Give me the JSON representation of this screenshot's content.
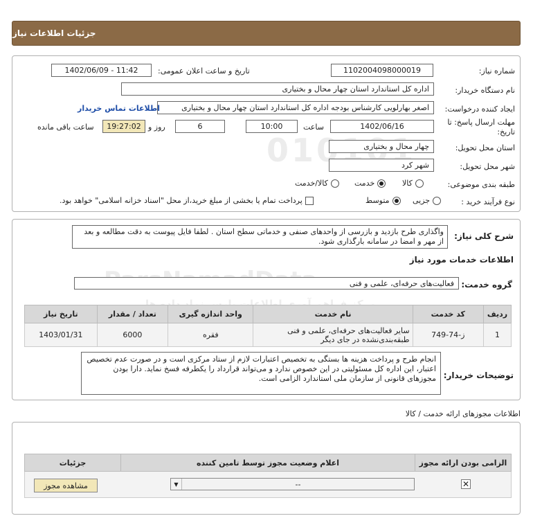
{
  "header": {
    "title": "جزئیات اطلاعات نیاز"
  },
  "form": {
    "need_number_label": "شماره نیاز:",
    "need_number": "1102004098000019",
    "announce_label": "تاریخ و ساعت اعلان عمومی:",
    "announce_value": "1402/06/09 - 11:42",
    "buyer_org_label": "نام دستگاه خریدار:",
    "buyer_org": "اداره کل استاندارد استان چهار محال و بختیاری",
    "creator_label": "ایجاد کننده درخواست:",
    "creator": "اصغر بهارلویی  کارشناس بودجه اداره کل استاندارد استان چهار محال و بختیاری",
    "contact_link": "اطلاعات تماس خریدار",
    "deadline_label_1": "مهلت ارسال پاسخ: تا",
    "deadline_label_2": "تاریخ:",
    "deadline_date": "1402/06/16",
    "time_label": "ساعت",
    "deadline_time": "10:00",
    "days_value": "6",
    "days_label": "روز و",
    "remaining_time": "19:27:02",
    "remaining_label": "ساعت باقی مانده",
    "province_label": "استان محل تحویل:",
    "province": "چهار محال و بختیاری",
    "city_label": "شهر محل تحویل:",
    "city": "شهر کرد",
    "category_label": "طبقه بندی موضوعی:",
    "category_options": [
      "کالا",
      "خدمت",
      "کالا/خدمت"
    ],
    "category_selected": "خدمت",
    "purchase_type_label": "نوع فرآیند خرید :",
    "purchase_options": [
      "جزیی",
      "متوسط"
    ],
    "purchase_selected": "متوسط",
    "payment_note": "پرداخت تمام یا بخشی از مبلغ خرید،از محل \"اسناد خزانه اسلامی\" خواهد بود."
  },
  "description": {
    "label": "شرح کلی نیاز:",
    "text": "واگذاری طرح بازدید و بازرسی از واحدهای صنفی و خدماتی سطح استان . لطفا فایل پیوست به دقت مطالعه و بعد از مهر و امضا در سامانه بارگذاری شود."
  },
  "services": {
    "section_title": "اطلاعات خدمات مورد نیاز",
    "group_label": "گروه خدمت:",
    "group_value": "فعالیت‌های حرفه‌ای، علمی و فنی",
    "columns": [
      "ردیف",
      "کد خدمت",
      "نام خدمت",
      "واحد اندازه گیری",
      "تعداد / مقدار",
      "تاریخ نیاز"
    ],
    "rows": [
      {
        "row": "1",
        "code": "ز-74-749",
        "name": "سایر فعالیت‌های حرفه‌ای، علمی و فنی طبقه‌بندی‌نشده در جای دیگر",
        "unit": "فقره",
        "qty": "6000",
        "date": "1403/01/31"
      }
    ]
  },
  "buyer_notes": {
    "label": "توضیحات خریدار:",
    "text": "انجام طرح و پرداخت هزینه ها بستگی به تخصیص اعتبارات لازم از ستاد مرکزی است و در صورت عدم تخصیص اعتبار، این اداره کل مسئولیتی در این خصوص ندارد و می‌تواند قرارداد را یکطرفه فسخ نماید. دارا بودن مجوزهای قانونی از سازمان ملی استاندارد الزامی است."
  },
  "permits": {
    "section_title": "اطلاعات مجوزهای ارائه خدمت / کالا",
    "columns": [
      "الزامی بودن ارائه مجوز",
      "اعلام وضعیت مجوز توسط تامین کننده",
      "جزئیات"
    ],
    "row_status": "--",
    "view_button": "مشاهده مجوز"
  },
  "watermark": {
    "text1": "ParsNamadData",
    "text2": "مرکز فراهم آوری اطلاعات پارس نماد داده ها",
    "text3": "پایگاه اطلاع رسانی مناقصه و مزایده",
    "digits": "010101"
  },
  "colors": {
    "header_bg": "#8b6a46",
    "accent_gold": "#f2e7b8",
    "link": "#1f4ea8"
  }
}
